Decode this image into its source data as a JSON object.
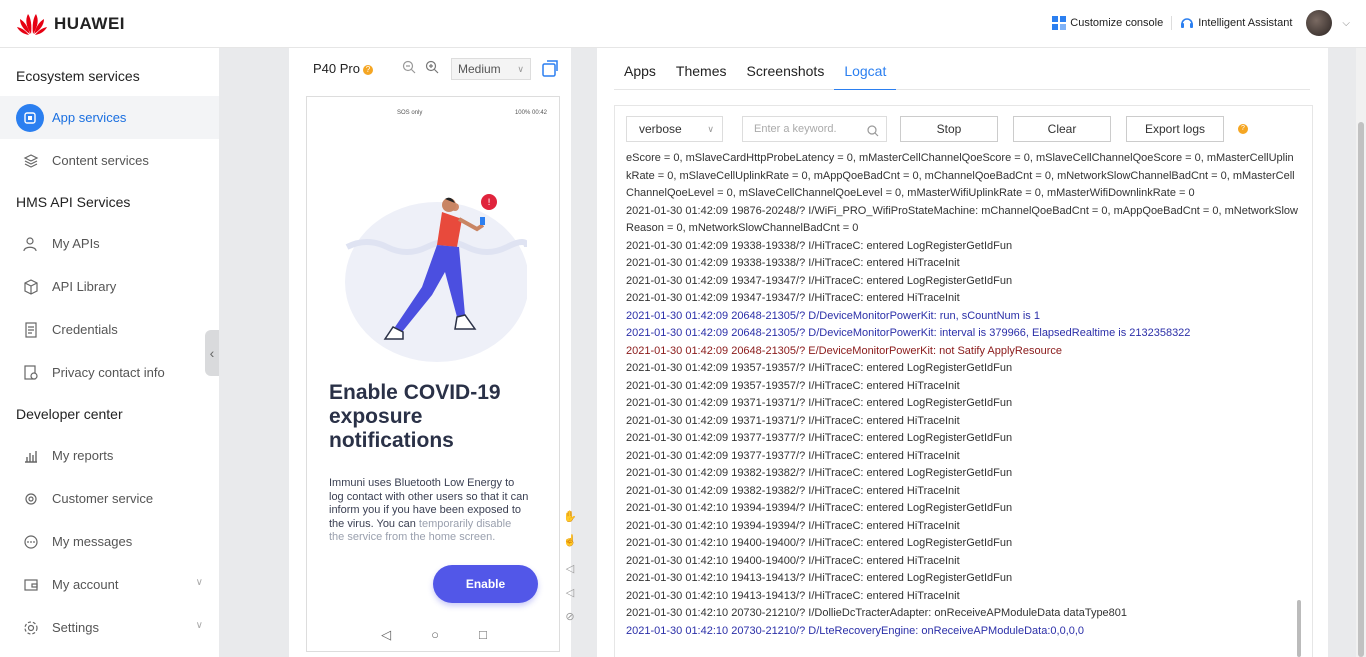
{
  "header": {
    "brand": "HUAWEI",
    "customize_console": "Customize console",
    "assistant": "Intelligent Assistant"
  },
  "sidebar": {
    "sections": [
      {
        "title": "Ecosystem services",
        "items": [
          {
            "label": "App services",
            "icon": "app-services-icon",
            "active": true
          },
          {
            "label": "Content services",
            "icon": "layers-icon"
          }
        ]
      },
      {
        "title": "HMS API Services",
        "items": [
          {
            "label": "My APIs",
            "icon": "api-user-icon"
          },
          {
            "label": "API Library",
            "icon": "cube-icon"
          },
          {
            "label": "Credentials",
            "icon": "document-icon"
          },
          {
            "label": "Privacy contact info",
            "icon": "privacy-icon"
          }
        ]
      },
      {
        "title": "Developer center",
        "items": [
          {
            "label": "My reports",
            "icon": "bar-chart-icon"
          },
          {
            "label": "Customer service",
            "icon": "headset-icon"
          },
          {
            "label": "My messages",
            "icon": "message-icon"
          },
          {
            "label": "My account",
            "icon": "wallet-icon"
          },
          {
            "label": "Settings",
            "icon": "gear-icon"
          }
        ]
      }
    ]
  },
  "device": {
    "name": "P40 Pro",
    "size_option": "Medium",
    "status_left": "SOS only",
    "status_right": "100% 00:42",
    "app_title": "Enable COVID-19 exposure notifications",
    "app_desc": "Immuni uses Bluetooth Low Energy to log contact with other users so that it can inform you if you have been exposed to the virus. You can",
    "app_desc_fade": "temporarily disable the service from the home screen.",
    "enable_label": "Enable"
  },
  "tabs": [
    "Apps",
    "Themes",
    "Screenshots",
    "Logcat"
  ],
  "active_tab": "Logcat",
  "logcat": {
    "level": "verbose",
    "search_placeholder": "Enter a keyword.",
    "stop_label": "Stop",
    "clear_label": "Clear",
    "export_label": "Export logs",
    "lines": [
      {
        "text": "eScore = 0, mSlaveCardHttpProbeLatency = 0, mMasterCellChannelQoeScore = 0, mSlaveCellChannelQoeScore = 0, mMasterCellUplinkRate = 0, mSlaveCellUplinkRate = 0, mAppQoeBadCnt = 0, mChannelQoeBadCnt = 0, mNetworkSlowChannelBadCnt = 0, mMasterCellChannelQoeLevel = 0, mSlaveCellChannelQoeLevel = 0, mMasterWifiUplinkRate = 0, mMasterWifiDownlinkRate = 0",
        "level": "i"
      },
      {
        "text": "2021-01-30 01:42:09 19876-20248/? I/WiFi_PRO_WifiProStateMachine: mChannelQoeBadCnt = 0, mAppQoeBadCnt = 0, mNetworkSlowReason = 0, mNetworkSlowChannelBadCnt = 0",
        "level": "i"
      },
      {
        "text": "2021-01-30 01:42:09 19338-19338/? I/HiTraceC: entered LogRegisterGetIdFun",
        "level": "i"
      },
      {
        "text": "2021-01-30 01:42:09 19338-19338/? I/HiTraceC: entered HiTraceInit",
        "level": "i"
      },
      {
        "text": "2021-01-30 01:42:09 19347-19347/? I/HiTraceC: entered LogRegisterGetIdFun",
        "level": "i"
      },
      {
        "text": "2021-01-30 01:42:09 19347-19347/? I/HiTraceC: entered HiTraceInit",
        "level": "i"
      },
      {
        "text": "2021-01-30 01:42:09 20648-21305/? D/DeviceMonitorPowerKit: run, sCountNum is 1",
        "level": "d"
      },
      {
        "text": "2021-01-30 01:42:09 20648-21305/? D/DeviceMonitorPowerKit: interval is 379966, ElapsedRealtime is 2132358322",
        "level": "d"
      },
      {
        "text": "2021-01-30 01:42:09 20648-21305/? E/DeviceMonitorPowerKit: not Satify ApplyResource",
        "level": "e"
      },
      {
        "text": "2021-01-30 01:42:09 19357-19357/? I/HiTraceC: entered LogRegisterGetIdFun",
        "level": "i"
      },
      {
        "text": "2021-01-30 01:42:09 19357-19357/? I/HiTraceC: entered HiTraceInit",
        "level": "i"
      },
      {
        "text": "2021-01-30 01:42:09 19371-19371/? I/HiTraceC: entered LogRegisterGetIdFun",
        "level": "i"
      },
      {
        "text": "2021-01-30 01:42:09 19371-19371/? I/HiTraceC: entered HiTraceInit",
        "level": "i"
      },
      {
        "text": "2021-01-30 01:42:09 19377-19377/? I/HiTraceC: entered LogRegisterGetIdFun",
        "level": "i"
      },
      {
        "text": "2021-01-30 01:42:09 19377-19377/? I/HiTraceC: entered HiTraceInit",
        "level": "i"
      },
      {
        "text": "2021-01-30 01:42:09 19382-19382/? I/HiTraceC: entered LogRegisterGetIdFun",
        "level": "i"
      },
      {
        "text": "2021-01-30 01:42:09 19382-19382/? I/HiTraceC: entered HiTraceInit",
        "level": "i"
      },
      {
        "text": "2021-01-30 01:42:10 19394-19394/? I/HiTraceC: entered LogRegisterGetIdFun",
        "level": "i"
      },
      {
        "text": "2021-01-30 01:42:10 19394-19394/? I/HiTraceC: entered HiTraceInit",
        "level": "i"
      },
      {
        "text": "2021-01-30 01:42:10 19400-19400/? I/HiTraceC: entered LogRegisterGetIdFun",
        "level": "i"
      },
      {
        "text": "2021-01-30 01:42:10 19400-19400/? I/HiTraceC: entered HiTraceInit",
        "level": "i"
      },
      {
        "text": "2021-01-30 01:42:10 19413-19413/? I/HiTraceC: entered LogRegisterGetIdFun",
        "level": "i"
      },
      {
        "text": "2021-01-30 01:42:10 19413-19413/? I/HiTraceC: entered HiTraceInit",
        "level": "i"
      },
      {
        "text": "2021-01-30 01:42:10 20730-21210/? I/DollieDcTracterAdapter: onReceiveAPModuleData dataType801",
        "level": "i"
      },
      {
        "text": "2021-01-30 01:42:10 20730-21210/? D/LteRecoveryEngine: onReceiveAPModuleData:0,0,0,0",
        "level": "d"
      }
    ]
  },
  "colors": {
    "accent": "#2b7ff0",
    "enable_button": "#5257e8",
    "log_debug": "#2b2fa8",
    "log_error": "#8a1a1a",
    "brand_red": "#e60012"
  }
}
